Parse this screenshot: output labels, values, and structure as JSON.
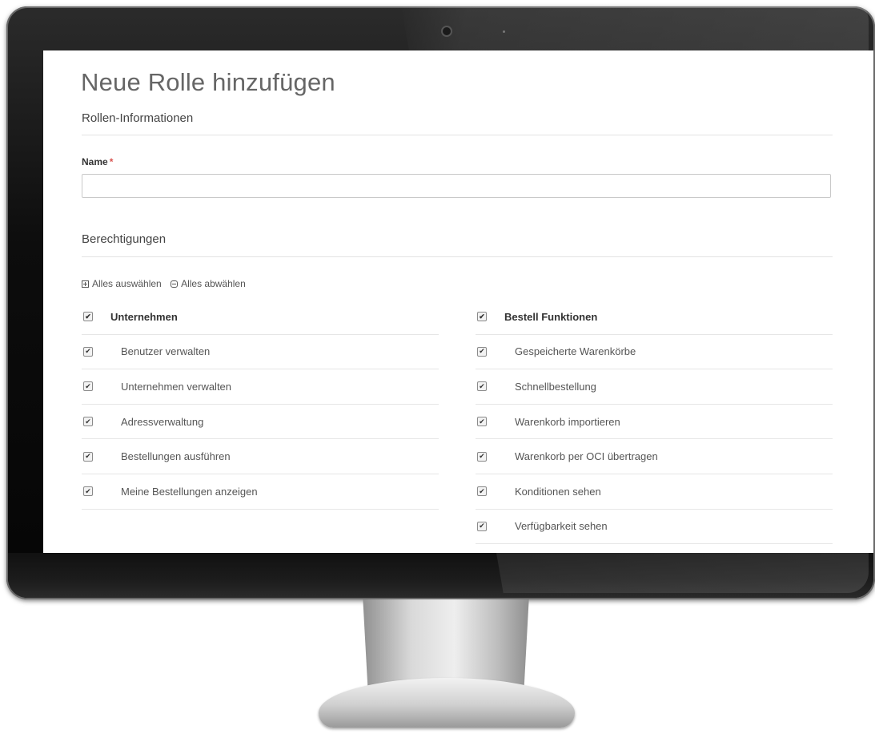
{
  "page": {
    "title": "Neue Rolle hinzufügen",
    "section_info": "Rollen-Informationen",
    "name_label": "Name",
    "required_marker": "*",
    "name_value": "",
    "section_permissions": "Berechtigungen",
    "select_all": "Alles auswählen",
    "deselect_all": "Alles abwählen"
  },
  "permissions": {
    "left": {
      "group": "Unternehmen",
      "items": [
        "Benutzer verwalten",
        "Unternehmen verwalten",
        "Adressverwaltung",
        "Bestellungen ausführen",
        "Meine Bestellungen anzeigen"
      ]
    },
    "right": {
      "group": "Bestell Funktionen",
      "items": [
        "Gespeicherte Warenkörbe",
        "Schnellbestellung",
        "Warenkorb importieren",
        "Warenkorb per OCI übertragen",
        "Konditionen sehen",
        "Verfügbarkeit sehen"
      ]
    }
  },
  "checkbox_glyph": "✔"
}
